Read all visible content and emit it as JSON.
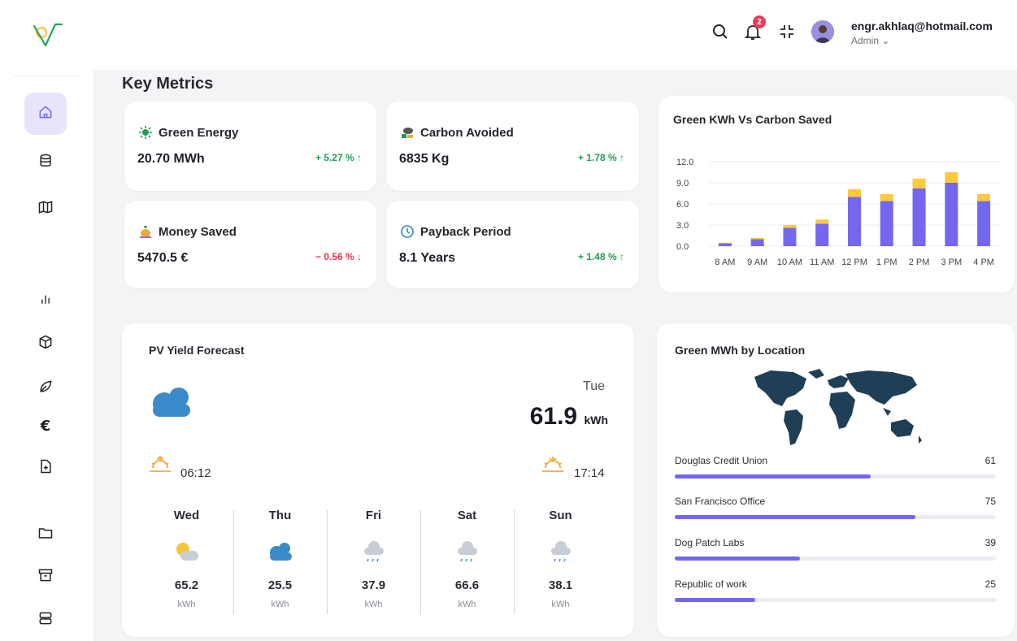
{
  "user": {
    "email": "engr.akhlaq@hotmail.com",
    "role": "Admin",
    "notifications": "2"
  },
  "page": {
    "section_title": "Key Metrics"
  },
  "metrics": [
    {
      "name": "Green Energy",
      "value": "20.70 MWh",
      "change": "+ 5.27 %",
      "direction": "up",
      "icon": "sun-icon",
      "color": "#1f9d55"
    },
    {
      "name": "Carbon Avoided",
      "value": "6835 Kg",
      "change": "+ 1.78 %",
      "direction": "up",
      "icon": "cloud-smoke-icon",
      "color": "#1f9d55"
    },
    {
      "name": "Money Saved",
      "value": "5470.5 €",
      "change": "− 0.56 %",
      "direction": "down",
      "icon": "money-bag-icon",
      "color": "#e2334f"
    },
    {
      "name": "Payback Period",
      "value": "8.1 Years",
      "change": "+ 1.48 %",
      "direction": "up",
      "icon": "clock-icon",
      "color": "#1f9d55"
    }
  ],
  "chart_card": {
    "title": "Green KWh Vs Carbon Saved"
  },
  "chart_data": {
    "type": "bar",
    "stacked": true,
    "categories": [
      "8 AM",
      "9 AM",
      "10 AM",
      "11 AM",
      "12 PM",
      "1 PM",
      "2 PM",
      "3 PM",
      "4 PM"
    ],
    "series": [
      {
        "values": [
          0.4,
          1.0,
          2.6,
          3.2,
          7.0,
          6.4,
          8.2,
          9.0,
          6.4
        ],
        "color": "#7367f0"
      },
      {
        "values": [
          0.1,
          0.2,
          0.4,
          0.6,
          1.1,
          1.0,
          1.4,
          1.5,
          1.0
        ],
        "color": "#ffc83d"
      }
    ],
    "yticks": [
      "0.0",
      "3.0",
      "6.0",
      "9.0",
      "12.0"
    ],
    "ylim": [
      0,
      12
    ],
    "grid": true
  },
  "forecast": {
    "title": "PV Yield Forecast",
    "day": "Tue",
    "total_value": "61.9",
    "total_unit": "kWh",
    "sunrise": "06:12",
    "sunset": "17:14",
    "days": [
      {
        "name": "Wed",
        "value": "65.2",
        "unit": "kWh",
        "icon": "partly-sunny-icon"
      },
      {
        "name": "Thu",
        "value": "25.5",
        "unit": "kWh",
        "icon": "cloud-icon"
      },
      {
        "name": "Fri",
        "value": "37.9",
        "unit": "kWh",
        "icon": "rain-icon"
      },
      {
        "name": "Sat",
        "value": "66.6",
        "unit": "kWh",
        "icon": "rain-icon"
      },
      {
        "name": "Sun",
        "value": "38.1",
        "unit": "kWh",
        "icon": "rain-icon"
      }
    ]
  },
  "locations": {
    "title": "Green MWh by Location",
    "max": 100,
    "items": [
      {
        "name": "Douglas Credit Union",
        "value": 61
      },
      {
        "name": "San Francisco Office",
        "value": 75
      },
      {
        "name": "Dog Patch Labs",
        "value": 39
      },
      {
        "name": "Republic of work",
        "value": 25
      }
    ]
  },
  "sidebar": {
    "icons": [
      "home-icon",
      "database-icon",
      "map-icon",
      "bar-chart-icon",
      "box-icon",
      "leaf-icon",
      "euro-icon",
      "file-plus-icon",
      "folder-icon",
      "archive-icon",
      "server-icon"
    ],
    "euro_symbol": "€"
  }
}
